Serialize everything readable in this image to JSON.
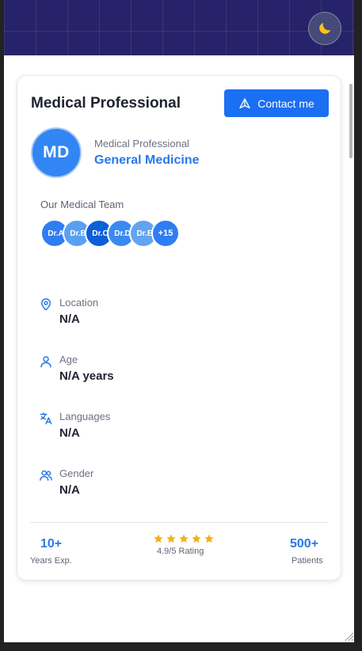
{
  "theme_toggle": {
    "icon": "moon-icon",
    "color": "#f6c31a"
  },
  "profile": {
    "title": "Medical Professional",
    "contact_label": "Contact me",
    "avatar_initials": "MD",
    "role": "Medical Professional",
    "specialty": "General Medicine"
  },
  "team": {
    "label": "Our Medical Team",
    "members": [
      "Dr.A",
      "Dr.B",
      "Dr.C",
      "Dr.D",
      "Dr.E"
    ],
    "more_label": "+15"
  },
  "details": [
    {
      "icon": "map-pin-icon",
      "label": "Location",
      "value": "N/A"
    },
    {
      "icon": "user-icon",
      "label": "Age",
      "value": "N/A years"
    },
    {
      "icon": "translate-icon",
      "label": "Languages",
      "value": "N/A"
    },
    {
      "icon": "users-icon",
      "label": "Gender",
      "value": "N/A"
    }
  ],
  "stats": {
    "experience": {
      "value": "10+",
      "label": "Years Exp."
    },
    "rating": {
      "stars": 5,
      "label": "4.9/5 Rating"
    },
    "patients": {
      "value": "500+",
      "label": "Patients"
    }
  },
  "colors": {
    "accent": "#1a6ff2",
    "hero_bg": "#26236a",
    "star": "#f2b01e"
  }
}
